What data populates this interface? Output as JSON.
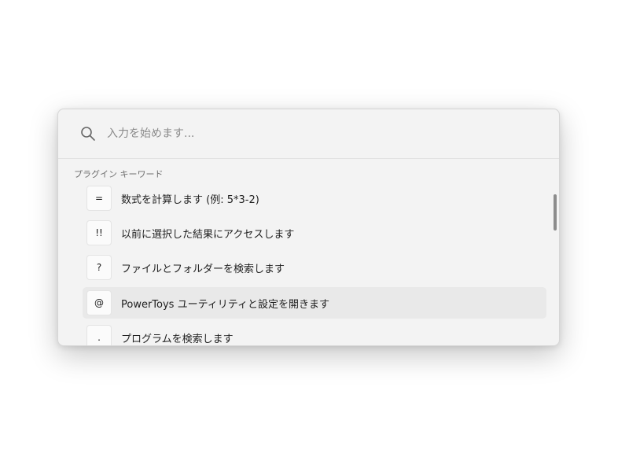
{
  "search": {
    "placeholder": "入力を始めます...",
    "value": ""
  },
  "section": {
    "header": "プラグイン キーワード"
  },
  "plugins": [
    {
      "keyword": "=",
      "label": "数式を計算します (例: 5*3-2)",
      "selected": false
    },
    {
      "keyword": "!!",
      "label": "以前に選択した結果にアクセスします",
      "selected": false
    },
    {
      "keyword": "?",
      "label": "ファイルとフォルダーを検索します",
      "selected": false
    },
    {
      "keyword": "@",
      "label": "PowerToys ユーティリティと設定を開きます",
      "selected": true
    },
    {
      "keyword": ".",
      "label": "プログラムを検索します",
      "selected": false
    }
  ],
  "icons": {
    "search": "search-icon"
  },
  "colors": {
    "panel_background": "#f3f3f3",
    "selected_row": "#e9e9e9",
    "scrollbar_thumb": "#8c8c8c"
  }
}
